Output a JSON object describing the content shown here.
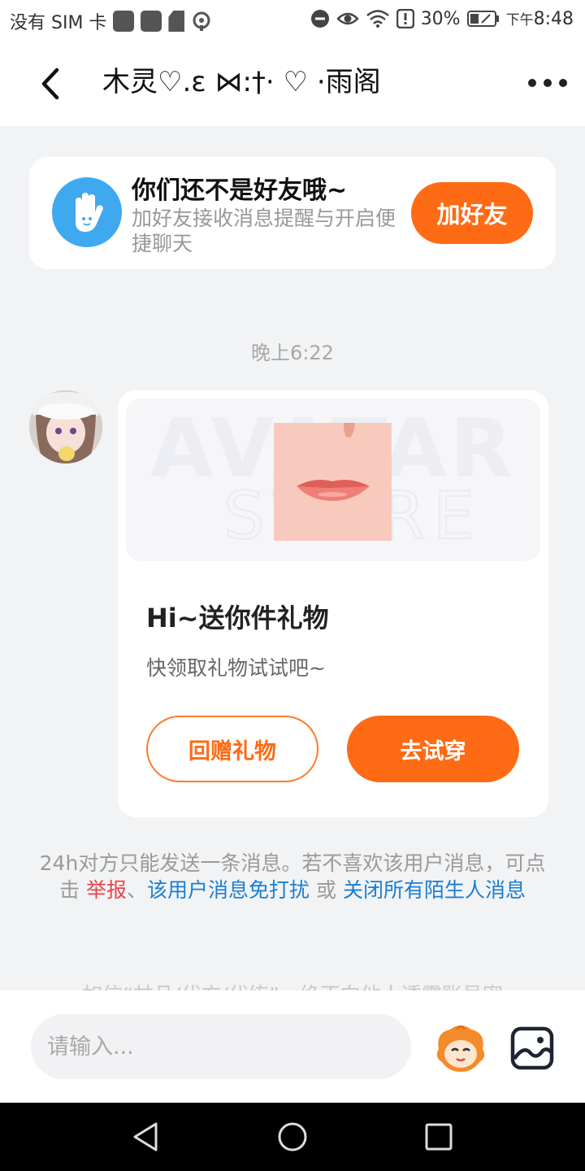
{
  "status_bar": {
    "carrier": "没有 SIM 卡",
    "battery": "30%",
    "time_prefix": "下午",
    "time": "8:48"
  },
  "header": {
    "title": "木灵♡.ɛ ⋈:†· ♡ ·雨阁"
  },
  "friend_prompt": {
    "title": "你们还不是好友哦~",
    "subtitle": "加好友接收消息提醒与开启便捷聊天",
    "button": "加好友"
  },
  "chat": {
    "timestamp": "晚上6:22"
  },
  "gift_card": {
    "watermark": "AVATAR",
    "title": "Hi~送你件礼物",
    "subtitle": "快领取礼物试试吧~",
    "return_button": "回赠礼物",
    "try_button": "去试穿"
  },
  "notice": {
    "text_1": "24h对方只能发送一条消息。若不喜欢该用户消息，可点击 ",
    "report": "举报",
    "sep": "、",
    "mute": "该用户消息免打扰",
    "or": " 或 ",
    "close_all": "关闭所有陌生人消息",
    "cut_off": "如信“甘品/代充/代练”，绝不向他人透露账号密"
  },
  "input_bar": {
    "placeholder": "请输入..."
  },
  "colors": {
    "accent": "#ff6a14",
    "link_blue": "#1a7fd1",
    "report_red": "#e84545"
  }
}
